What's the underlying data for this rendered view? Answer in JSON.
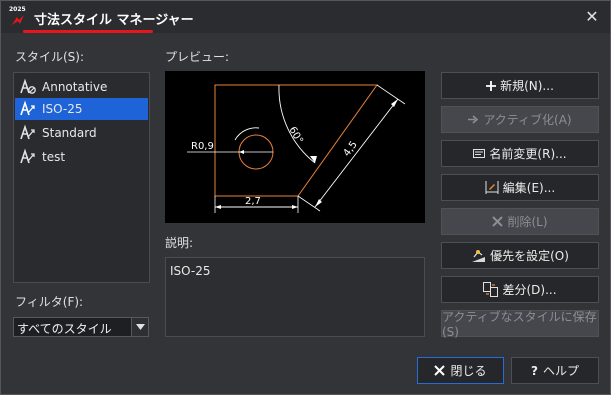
{
  "window": {
    "title": "寸法スタイル マネージャー",
    "brand_year": "2025"
  },
  "styles_label": "スタイル(S):",
  "styles": [
    {
      "name": "Annotative"
    },
    {
      "name": "ISO-25",
      "selected": true
    },
    {
      "name": "Standard"
    },
    {
      "name": "test"
    }
  ],
  "filter": {
    "label": "フィルタ(F):",
    "value": "すべてのスタイル"
  },
  "preview": {
    "label": "プレビュー:",
    "dimensions": {
      "radius": "R0,9",
      "angle": "60°",
      "aligned": "4,5",
      "linear": "2,7"
    }
  },
  "description": {
    "label": "説明:",
    "value": "ISO-25"
  },
  "buttons": {
    "new": "新規(N)...",
    "set_current": "アクティブ化(A)",
    "rename": "名前変更(R)...",
    "edit": "編集(E)...",
    "delete": "削除(L)",
    "override": "優先を設定(O)",
    "compare": "差分(D)...",
    "save_active": "アクティブなスタイルに保存(S)",
    "close": "閉じる",
    "help": "ヘルプ"
  },
  "colors": {
    "accent": "#1e64d8",
    "brand_red": "#e8151b",
    "preview_outline": "#e8823a",
    "dimension": "#ffffff"
  }
}
